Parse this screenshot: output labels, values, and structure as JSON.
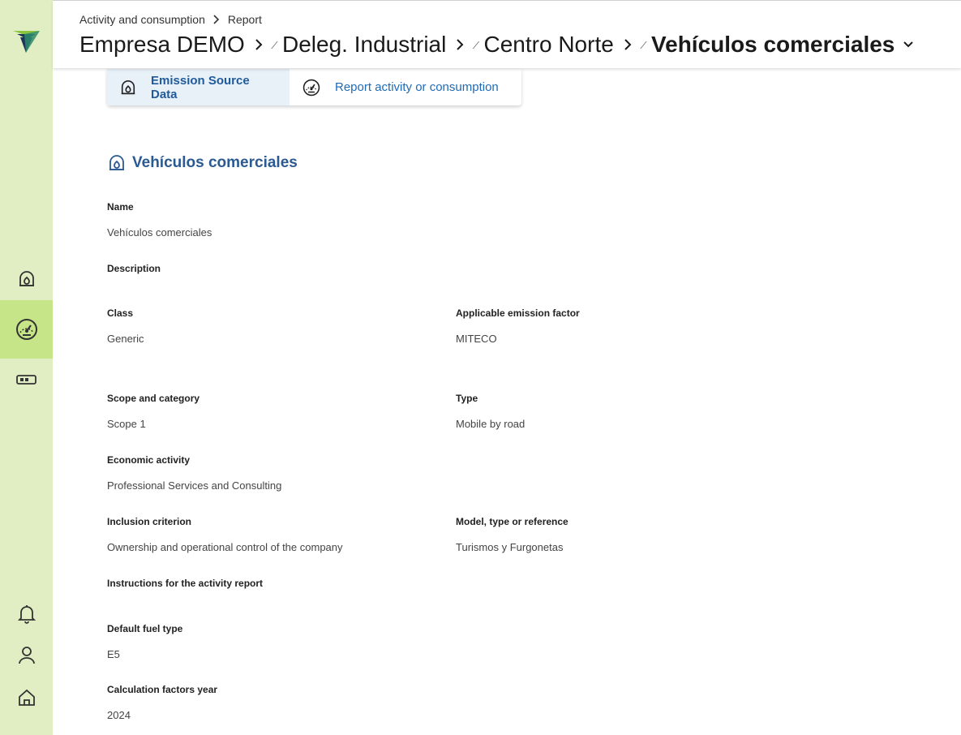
{
  "breadcrumb": {
    "parent": "Activity and consumption",
    "current": "Report"
  },
  "title": {
    "company": "Empresa DEMO",
    "delegation": "Deleg. Industrial",
    "center": "Centro Norte",
    "source": "Vehículos comerciales"
  },
  "tabs": [
    {
      "label": "Emission Source Data",
      "icon": "emission-source-icon"
    },
    {
      "label": "Report activity or consumption",
      "icon": "gauge-icon"
    }
  ],
  "section": {
    "title": "Vehículos comerciales",
    "icon": "emission-source-icon"
  },
  "fields": {
    "name": {
      "label": "Name",
      "value": "Vehículos comerciales"
    },
    "description": {
      "label": "Description",
      "value": ""
    },
    "class": {
      "label": "Class",
      "value": "Generic"
    },
    "emission_factor": {
      "label": "Applicable emission factor",
      "value": "MITECO"
    },
    "scope": {
      "label": "Scope and category",
      "value": "Scope 1"
    },
    "type": {
      "label": "Type",
      "value": "Mobile by road"
    },
    "economic_activity": {
      "label": "Economic activity",
      "value": "Professional Services and Consulting"
    },
    "inclusion": {
      "label": "Inclusion criterion",
      "value": "Ownership and operational control of the company"
    },
    "model": {
      "label": "Model, type or reference",
      "value": "Turismos y Furgonetas"
    },
    "instructions": {
      "label": "Instructions for the activity report",
      "value": ""
    },
    "fuel": {
      "label": "Default fuel type",
      "value": "E5"
    },
    "year": {
      "label": "Calculation factors year",
      "value": "2024"
    }
  },
  "sidebar": {
    "items": [
      "emission-sources-icon",
      "activity-gauge-icon",
      "battery-icon",
      "bell-icon",
      "user-icon",
      "home-icon"
    ],
    "active": "activity-gauge-icon"
  },
  "colors": {
    "sidebar": "#e1eec3",
    "sidebar_active": "#c6e488",
    "accent": "#2b5a93",
    "logo_green": "#8cc63f",
    "logo_navy": "#1e3559"
  }
}
